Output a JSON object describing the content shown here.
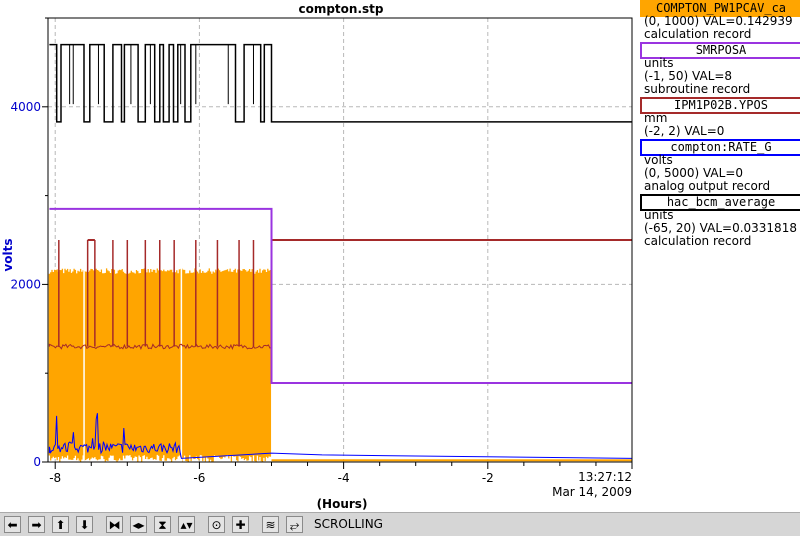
{
  "chart_data": {
    "type": "line",
    "title": "compton.stp",
    "xlabel": "(Hours)",
    "ylabel": "volts",
    "xlim": [
      -8.1,
      0
    ],
    "ylim": [
      0,
      5000
    ],
    "x_ticks": [
      -8,
      -6,
      -4,
      -2
    ],
    "y_ticks": [
      0,
      2000,
      4000
    ],
    "end_time": "13:27:12",
    "end_date": "Mar 14, 2009",
    "grid": true,
    "series": [
      {
        "name": "COMPTON_PW1PCAV_ca",
        "color": "#ffa500",
        "range": [
          0,
          1000
        ],
        "val": "0.142939"
      },
      {
        "name": "SMRPOSA",
        "color": "#9a34e0",
        "range": [
          -1,
          50
        ],
        "val": "8"
      },
      {
        "name": "IPM1P02B.YPOS",
        "color": "#a52a2a",
        "range": [
          -2,
          2
        ],
        "val": "0"
      },
      {
        "name": "compton:RATE_G",
        "color": "#0000ff",
        "range": [
          0,
          5000
        ],
        "val": "0"
      },
      {
        "name": "hac_bcm_average",
        "color": "#000000",
        "range": [
          -65,
          20
        ],
        "val": "0.0331818"
      }
    ],
    "traces": {
      "hac_bcm_average": {
        "high": 4700,
        "low": 3830,
        "after": 3830,
        "step_at": -5.0
      },
      "SMRPOSA": {
        "before": 2850,
        "after": 890,
        "step_at": -5.0
      },
      "IPM1P02B.YPOS": {
        "base": 1300,
        "spike": 2500,
        "after": 2500,
        "step_at": -5.0
      },
      "COMPTON_PW1PCAV_ca": {
        "high": 2150,
        "low": 0,
        "after": 20,
        "step_at": -5.0
      },
      "compton:RATE_G": {
        "base": 100,
        "burst": 450,
        "after": 40,
        "step_at": -5.0
      }
    }
  },
  "legend": {
    "items": [
      {
        "name": "COMPTON_PW1PCAV_ca",
        "color": "#ffa500",
        "lines": [
          "(0, 1000) VAL=0.142939",
          "calculation record"
        ]
      },
      {
        "name": "SMRPOSA",
        "color": "#9a34e0",
        "lines": [
          "units",
          "(-1, 50) VAL=8",
          "subroutine record"
        ]
      },
      {
        "name": "IPM1P02B.YPOS",
        "color": "#a52a2a",
        "lines": [
          "mm",
          "(-2, 2) VAL=0"
        ]
      },
      {
        "name": "compton:RATE_G",
        "color": "#0000ff",
        "lines": [
          "volts",
          "(0, 5000) VAL=0",
          "analog output record"
        ]
      },
      {
        "name": "hac_bcm_average",
        "color": "#000000",
        "lines": [
          "units",
          "(-65, 20) VAL=0.0331818",
          "calculation record"
        ]
      }
    ]
  },
  "toolbar": {
    "status": "SCROLLING",
    "buttons": [
      {
        "name": "pan-left-button",
        "icon": "arrow-left-icon",
        "glyph": "⬅"
      },
      {
        "name": "pan-right-button",
        "icon": "arrow-right-icon",
        "glyph": "➡"
      },
      {
        "name": "pan-up-button",
        "icon": "arrow-up-icon",
        "glyph": "⬆"
      },
      {
        "name": "pan-down-button",
        "icon": "arrow-down-icon",
        "glyph": "⬇"
      },
      {
        "name": "zoom-in-x-button",
        "icon": "zoom-in-x-icon",
        "glyph": "⧓"
      },
      {
        "name": "zoom-out-x-button",
        "icon": "zoom-out-x-icon",
        "glyph": "◂▸"
      },
      {
        "name": "zoom-in-y-button",
        "icon": "zoom-in-y-icon",
        "glyph": "⧗"
      },
      {
        "name": "zoom-out-y-button",
        "icon": "zoom-out-y-icon",
        "glyph": "▴▾"
      },
      {
        "name": "autoscale-button",
        "icon": "circle-icon",
        "glyph": "⊙"
      },
      {
        "name": "zoom-button",
        "icon": "plus-icon",
        "glyph": "✚"
      },
      {
        "name": "stagger-button",
        "icon": "stagger-icon",
        "glyph": "≋"
      },
      {
        "name": "unstagger-button",
        "icon": "unstagger-icon",
        "glyph": "⥂"
      }
    ]
  }
}
